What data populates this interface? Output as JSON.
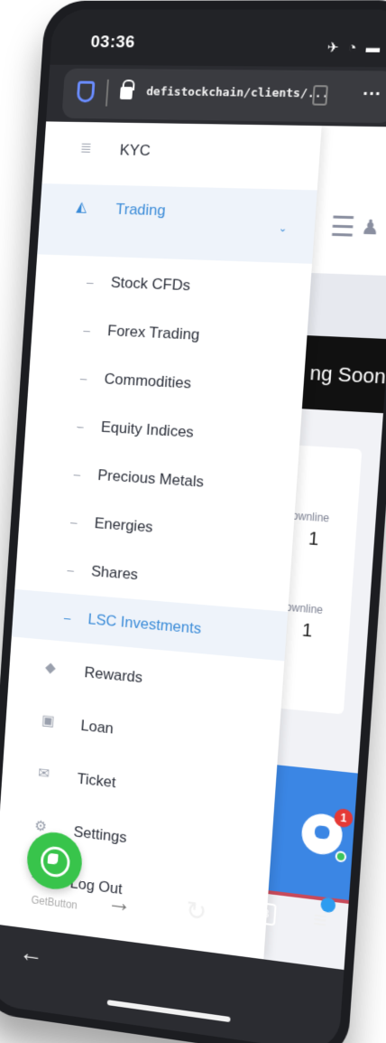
{
  "status_bar": {
    "time": "03:36"
  },
  "url_bar": {
    "url": "defistockchain/clients/..."
  },
  "page": {
    "banner_text": "ng Soon",
    "stats": [
      {
        "label": "ownline",
        "value": "1"
      },
      {
        "label": "ownline",
        "value": "1"
      }
    ],
    "chat_badge_count": "1"
  },
  "drawer": {
    "items": [
      {
        "label": "KYC",
        "icon": "database-icon"
      },
      {
        "label": "Trading",
        "icon": "chart-area-icon",
        "active": true
      },
      {
        "label": "Stock CFDs",
        "sub": true
      },
      {
        "label": "Forex Trading",
        "sub": true
      },
      {
        "label": "Commodities",
        "sub": true
      },
      {
        "label": "Equity Indices",
        "sub": true
      },
      {
        "label": "Precious Metals",
        "sub": true
      },
      {
        "label": "Energies",
        "sub": true
      },
      {
        "label": "Shares",
        "sub": true
      },
      {
        "label": "LSC Investments",
        "sub": true,
        "active": true
      },
      {
        "label": "Rewards",
        "icon": "diamond-icon"
      },
      {
        "label": "Loan",
        "icon": "money-icon"
      },
      {
        "label": "Ticket",
        "icon": "envelope-icon"
      },
      {
        "label": "Settings",
        "icon": "gear-icon"
      },
      {
        "label": "Log Out",
        "icon": "logout-icon"
      }
    ]
  },
  "whatsapp": {
    "caption": "GetButton"
  },
  "toolbar": {
    "tab_count": "3"
  },
  "colors": {
    "accent": "#3a8bd8",
    "whatsapp": "#38c44b",
    "active_bg": "#eef3fa"
  }
}
